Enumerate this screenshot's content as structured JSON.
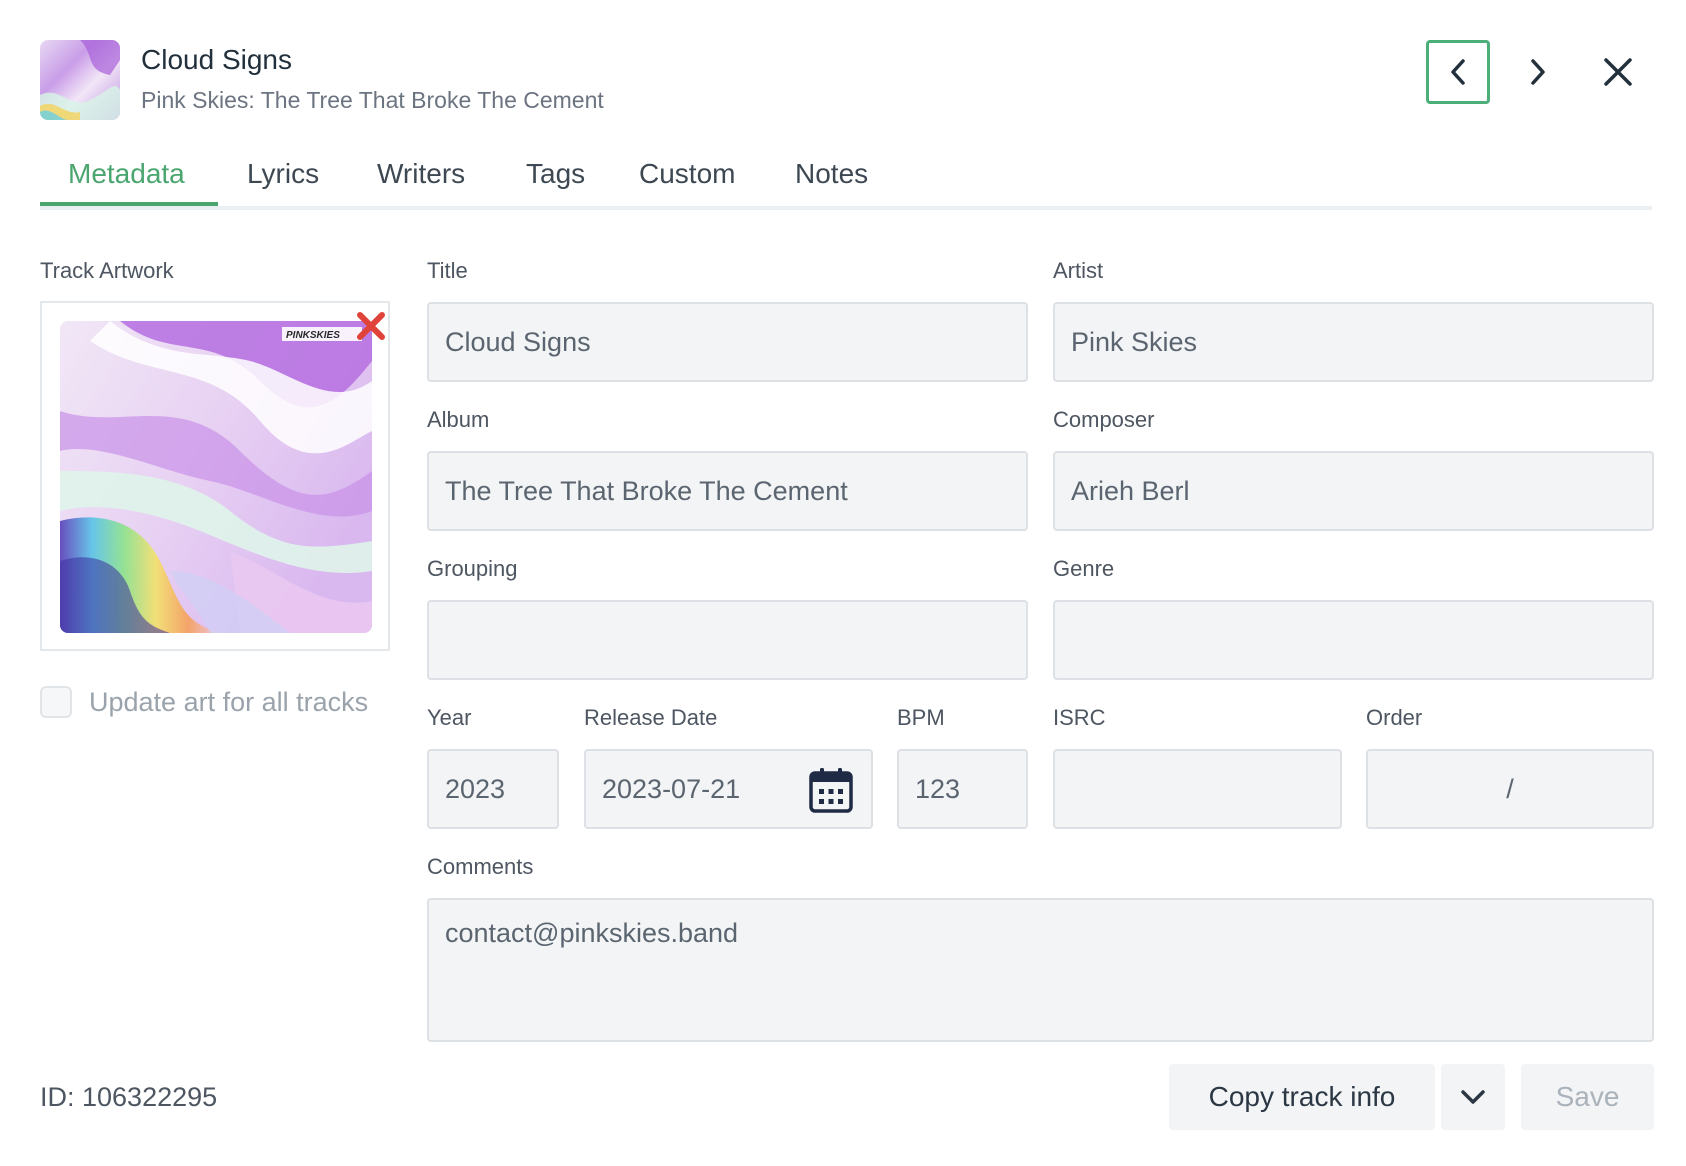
{
  "header": {
    "title": "Cloud Signs",
    "subtitle": "Pink Skies: The Tree That Broke The Cement",
    "thumbnail_icon": "album-art-thumbnail",
    "prev_icon": "chevron-left-icon",
    "next_icon": "chevron-right-icon",
    "close_icon": "close-icon",
    "accent_color": "#4caf7a"
  },
  "tabs": [
    {
      "label": "Metadata",
      "active": true
    },
    {
      "label": "Lyrics",
      "active": false
    },
    {
      "label": "Writers",
      "active": false
    },
    {
      "label": "Tags",
      "active": false
    },
    {
      "label": "Custom",
      "active": false
    },
    {
      "label": "Notes",
      "active": false
    }
  ],
  "artwork": {
    "label": "Track Artwork",
    "remove_icon": "remove-x-icon",
    "remove_color": "#e0433a",
    "update_all_label": "Update art for all tracks",
    "update_all_checked": false
  },
  "fields": {
    "title": {
      "label": "Title",
      "value": "Cloud Signs"
    },
    "artist": {
      "label": "Artist",
      "value": "Pink Skies"
    },
    "album": {
      "label": "Album",
      "value": "The Tree That Broke The Cement"
    },
    "composer": {
      "label": "Composer",
      "value": "Arieh Berl"
    },
    "grouping": {
      "label": "Grouping",
      "value": ""
    },
    "genre": {
      "label": "Genre",
      "value": ""
    },
    "year": {
      "label": "Year",
      "value": "2023"
    },
    "release_date": {
      "label": "Release Date",
      "value": "2023-07-21",
      "icon": "calendar-icon"
    },
    "bpm": {
      "label": "BPM",
      "value": "123"
    },
    "isrc": {
      "label": "ISRC",
      "value": ""
    },
    "order": {
      "label": "Order",
      "value": "/"
    },
    "comments": {
      "label": "Comments",
      "value": "contact@pinkskies.band"
    }
  },
  "footer": {
    "id_text": "ID: 106322295",
    "copy_label": "Copy track info",
    "dropdown_icon": "chevron-down-icon",
    "save_label": "Save"
  }
}
